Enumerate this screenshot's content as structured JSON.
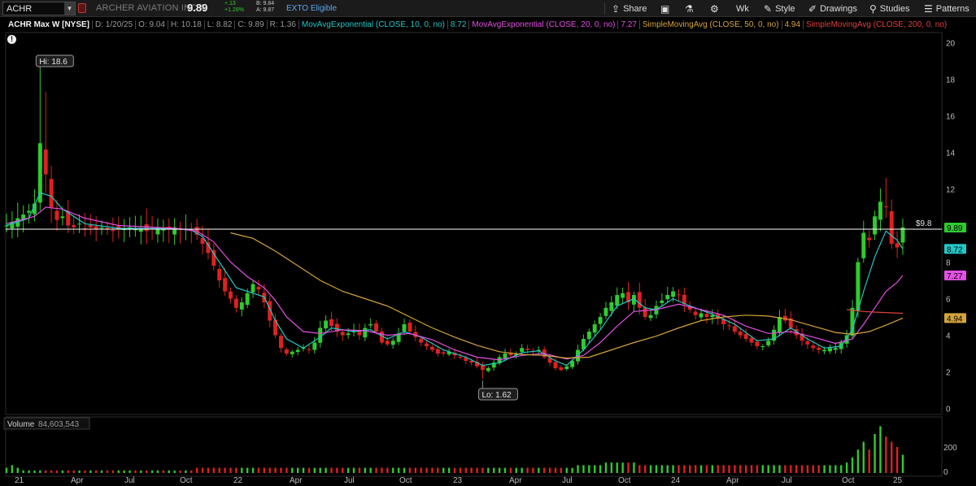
{
  "toolbar": {
    "symbol": "ACHR",
    "company_name": "ARCHER AVIATION INC A",
    "last_price": "9.89",
    "change": "+.13",
    "change_pct": "+1.28%",
    "bid": "B: 9.84",
    "ask": "A: 9.87",
    "exto": "EXTO Eligible",
    "share_label": "Share",
    "timeframe_label": "Wk",
    "style_label": "Style",
    "drawings_label": "Drawings",
    "studies_label": "Studies",
    "patterns_label": "Patterns"
  },
  "chart_header": {
    "title": "ACHR Max W [NYSE]",
    "date": "D: 1/20/25",
    "open": "O: 9.04",
    "high": "H: 10.18",
    "low": "L: 8.82",
    "close": "C: 9.89",
    "range": "R: 1.36",
    "studies": [
      {
        "label": "MovAvgExponential (CLOSE, 10, 0, no)",
        "value": "8.72",
        "color": "#23c7c7"
      },
      {
        "label": "MovAvgExponential (CLOSE, 20, 0, no)",
        "value": "7.27",
        "color": "#e54fe5"
      },
      {
        "label": "SimpleMovingAvg (CLOSE, 50, 0, no)",
        "value": "4.94",
        "color": "#d4a53b"
      },
      {
        "label": "SimpleMovingAvg (CLOSE, 200, 0, no)",
        "value": "",
        "color": "#e04040"
      }
    ]
  },
  "annotations": {
    "hi_label": "Hi: 18.6",
    "lo_label": "Lo: 1.62",
    "price_line_label": "$9.8",
    "price_line_value": 9.8
  },
  "badges": [
    {
      "text": "9.89",
      "value": 9.89,
      "color": "#2ecc2e"
    },
    {
      "text": "8.72",
      "value": 8.72,
      "color": "#23c7c7"
    },
    {
      "text": "7.27",
      "value": 7.27,
      "color": "#e54fe5"
    },
    {
      "text": "4.94",
      "value": 4.94,
      "color": "#d4a53b"
    }
  ],
  "volume": {
    "label": "Volume",
    "value": "84,603,543",
    "y_ticks": [
      "200",
      "0"
    ]
  },
  "chart_data": {
    "type": "candlestick",
    "y_ticks": [
      20,
      18,
      16,
      14,
      12,
      10,
      8,
      6,
      4,
      2,
      0
    ],
    "ylim": [
      0,
      20.5
    ],
    "x_labels": [
      "21",
      "Apr",
      "Jul",
      "Oct",
      "22",
      "Apr",
      "Jul",
      "Oct",
      "23",
      "Apr",
      "Jul",
      "Oct",
      "24",
      "Apr",
      "Jul",
      "Oct",
      "25"
    ],
    "close_path": [
      [
        0,
        10.0
      ],
      [
        1,
        10.2
      ],
      [
        2,
        10.4
      ],
      [
        3,
        10.6
      ],
      [
        4,
        10.8
      ],
      [
        5,
        11.2
      ],
      [
        6,
        14.5
      ],
      [
        7,
        12.8
      ],
      [
        8,
        11.0
      ],
      [
        9,
        10.3
      ],
      [
        10,
        10.5
      ],
      [
        11,
        10.0
      ],
      [
        12,
        9.9
      ],
      [
        13,
        10.1
      ],
      [
        14,
        9.8
      ],
      [
        15,
        9.9
      ],
      [
        16,
        9.8
      ],
      [
        17,
        9.9
      ],
      [
        18,
        9.8
      ],
      [
        19,
        9.7
      ],
      [
        20,
        9.8
      ],
      [
        21,
        9.8
      ],
      [
        22,
        9.9
      ],
      [
        23,
        9.8
      ],
      [
        24,
        9.8
      ],
      [
        25,
        9.7
      ],
      [
        26,
        9.8
      ],
      [
        27,
        9.9
      ],
      [
        28,
        9.8
      ],
      [
        29,
        9.8
      ],
      [
        30,
        9.9
      ],
      [
        31,
        9.8
      ],
      [
        32,
        9.8
      ],
      [
        33,
        9.7
      ],
      [
        34,
        9.5
      ],
      [
        35,
        9.0
      ],
      [
        36,
        8.5
      ],
      [
        37,
        7.8
      ],
      [
        38,
        7.0
      ],
      [
        39,
        6.4
      ],
      [
        40,
        6.0
      ],
      [
        41,
        5.5
      ],
      [
        42,
        5.8
      ],
      [
        43,
        6.3
      ],
      [
        44,
        6.8
      ],
      [
        45,
        6.5
      ],
      [
        46,
        5.8
      ],
      [
        47,
        4.8
      ],
      [
        48,
        4.0
      ],
      [
        49,
        3.3
      ],
      [
        50,
        3.0
      ],
      [
        51,
        3.1
      ],
      [
        52,
        3.2
      ],
      [
        53,
        3.3
      ],
      [
        54,
        3.2
      ],
      [
        55,
        3.6
      ],
      [
        56,
        4.4
      ],
      [
        57,
        4.8
      ],
      [
        58,
        4.5
      ],
      [
        59,
        4.2
      ],
      [
        60,
        4.0
      ],
      [
        61,
        4.1
      ],
      [
        62,
        4.3
      ],
      [
        63,
        4.0
      ],
      [
        64,
        4.4
      ],
      [
        65,
        4.6
      ],
      [
        66,
        4.2
      ],
      [
        67,
        3.6
      ],
      [
        68,
        3.5
      ],
      [
        69,
        3.7
      ],
      [
        70,
        4.1
      ],
      [
        71,
        4.6
      ],
      [
        72,
        4.2
      ],
      [
        73,
        3.9
      ],
      [
        74,
        3.6
      ],
      [
        75,
        3.4
      ],
      [
        76,
        3.2
      ],
      [
        77,
        3.0
      ],
      [
        78,
        3.0
      ],
      [
        79,
        3.1
      ],
      [
        80,
        2.9
      ],
      [
        81,
        2.8
      ],
      [
        82,
        2.6
      ],
      [
        83,
        2.5
      ],
      [
        84,
        2.3
      ],
      [
        85,
        2.1
      ],
      [
        86,
        2.2
      ],
      [
        87,
        2.5
      ],
      [
        88,
        2.8
      ],
      [
        89,
        3.0
      ],
      [
        90,
        2.9
      ],
      [
        91,
        3.0
      ],
      [
        92,
        3.3
      ],
      [
        93,
        3.2
      ],
      [
        94,
        3.1
      ],
      [
        95,
        3.2
      ],
      [
        96,
        2.8
      ],
      [
        97,
        2.5
      ],
      [
        98,
        2.2
      ],
      [
        99,
        2.1
      ],
      [
        100,
        2.3
      ],
      [
        101,
        2.6
      ],
      [
        102,
        3.2
      ],
      [
        103,
        3.8
      ],
      [
        104,
        4.2
      ],
      [
        105,
        4.6
      ],
      [
        106,
        5.0
      ],
      [
        107,
        5.5
      ],
      [
        108,
        5.8
      ],
      [
        109,
        6.2
      ],
      [
        110,
        6.3
      ],
      [
        111,
        5.8
      ],
      [
        112,
        6.2
      ],
      [
        113,
        5.5
      ],
      [
        114,
        5.0
      ],
      [
        115,
        5.1
      ],
      [
        116,
        5.6
      ],
      [
        117,
        5.9
      ],
      [
        118,
        6.2
      ],
      [
        119,
        6.4
      ],
      [
        120,
        6.2
      ],
      [
        121,
        5.7
      ],
      [
        122,
        5.4
      ],
      [
        123,
        5.1
      ],
      [
        124,
        5.2
      ],
      [
        125,
        5.0
      ],
      [
        126,
        5.1
      ],
      [
        127,
        4.9
      ],
      [
        128,
        4.6
      ],
      [
        129,
        4.5
      ],
      [
        130,
        4.2
      ],
      [
        131,
        4.0
      ],
      [
        132,
        3.8
      ],
      [
        133,
        3.6
      ],
      [
        134,
        3.4
      ],
      [
        135,
        3.4
      ],
      [
        136,
        3.7
      ],
      [
        137,
        4.3
      ],
      [
        138,
        5.0
      ],
      [
        139,
        4.8
      ],
      [
        140,
        4.4
      ],
      [
        141,
        4.0
      ],
      [
        142,
        3.7
      ],
      [
        143,
        3.5
      ],
      [
        144,
        3.3
      ],
      [
        145,
        3.2
      ],
      [
        146,
        3.2
      ],
      [
        147,
        3.3
      ],
      [
        148,
        3.3
      ],
      [
        149,
        3.6
      ],
      [
        150,
        4.0
      ],
      [
        151,
        5.5
      ],
      [
        152,
        8.0
      ],
      [
        153,
        9.6
      ],
      [
        154,
        9.2
      ],
      [
        155,
        10.5
      ],
      [
        156,
        11.3
      ],
      [
        157,
        11.0
      ],
      [
        158,
        9.0
      ],
      [
        159,
        8.8
      ],
      [
        160,
        9.9
      ]
    ],
    "series": [
      {
        "name": "MovAvgExponential (CLOSE, 10, 0, no)",
        "color": "#23c7c7",
        "values": [
          [
            0,
            10.0
          ],
          [
            4,
            10.4
          ],
          [
            6,
            11.8
          ],
          [
            8,
            11.6
          ],
          [
            10,
            10.9
          ],
          [
            14,
            10.1
          ],
          [
            20,
            9.85
          ],
          [
            30,
            9.82
          ],
          [
            33,
            9.75
          ],
          [
            35,
            9.4
          ],
          [
            38,
            8.0
          ],
          [
            41,
            6.6
          ],
          [
            44,
            6.3
          ],
          [
            46,
            6.1
          ],
          [
            48,
            4.8
          ],
          [
            50,
            3.8
          ],
          [
            53,
            3.3
          ],
          [
            56,
            3.9
          ],
          [
            58,
            4.4
          ],
          [
            62,
            4.2
          ],
          [
            65,
            4.3
          ],
          [
            68,
            3.8
          ],
          [
            71,
            4.2
          ],
          [
            74,
            3.9
          ],
          [
            78,
            3.2
          ],
          [
            82,
            2.8
          ],
          [
            85,
            2.35
          ],
          [
            88,
            2.5
          ],
          [
            92,
            3.05
          ],
          [
            95,
            3.15
          ],
          [
            98,
            2.6
          ],
          [
            100,
            2.35
          ],
          [
            103,
            3.2
          ],
          [
            106,
            4.3
          ],
          [
            109,
            5.6
          ],
          [
            112,
            6.0
          ],
          [
            114,
            5.5
          ],
          [
            116,
            5.4
          ],
          [
            119,
            6.0
          ],
          [
            122,
            5.6
          ],
          [
            126,
            5.15
          ],
          [
            130,
            4.6
          ],
          [
            134,
            3.7
          ],
          [
            137,
            3.8
          ],
          [
            140,
            4.4
          ],
          [
            143,
            3.8
          ],
          [
            146,
            3.3
          ],
          [
            149,
            3.4
          ],
          [
            151,
            4.3
          ],
          [
            153,
            6.4
          ],
          [
            155,
            8.3
          ],
          [
            157,
            9.7
          ],
          [
            159,
            9.2
          ],
          [
            160,
            8.72
          ]
        ]
      },
      {
        "name": "MovAvgExponential (CLOSE, 20, 0, no)",
        "color": "#e54fe5",
        "values": [
          [
            0,
            10.1
          ],
          [
            5,
            10.5
          ],
          [
            7,
            11.0
          ],
          [
            10,
            10.9
          ],
          [
            14,
            10.4
          ],
          [
            20,
            10.0
          ],
          [
            30,
            9.85
          ],
          [
            34,
            9.7
          ],
          [
            37,
            9.1
          ],
          [
            40,
            8.0
          ],
          [
            43,
            7.2
          ],
          [
            46,
            6.6
          ],
          [
            48,
            5.9
          ],
          [
            50,
            5.0
          ],
          [
            53,
            4.2
          ],
          [
            56,
            4.1
          ],
          [
            60,
            4.3
          ],
          [
            64,
            4.25
          ],
          [
            68,
            4.0
          ],
          [
            72,
            4.1
          ],
          [
            76,
            3.75
          ],
          [
            80,
            3.2
          ],
          [
            84,
            2.8
          ],
          [
            88,
            2.65
          ],
          [
            92,
            2.9
          ],
          [
            96,
            3.0
          ],
          [
            100,
            2.7
          ],
          [
            103,
            2.9
          ],
          [
            106,
            3.6
          ],
          [
            109,
            4.5
          ],
          [
            112,
            5.3
          ],
          [
            116,
            5.4
          ],
          [
            120,
            5.7
          ],
          [
            124,
            5.4
          ],
          [
            128,
            5.1
          ],
          [
            132,
            4.5
          ],
          [
            136,
            4.1
          ],
          [
            140,
            4.2
          ],
          [
            144,
            3.9
          ],
          [
            148,
            3.55
          ],
          [
            151,
            3.8
          ],
          [
            153,
            4.6
          ],
          [
            155,
            5.5
          ],
          [
            157,
            6.4
          ],
          [
            159,
            6.9
          ],
          [
            160,
            7.27
          ]
        ]
      },
      {
        "name": "SimpleMovingAvg (CLOSE, 50, 0, no)",
        "color": "#d4a53b",
        "values": [
          [
            40,
            9.6
          ],
          [
            44,
            9.3
          ],
          [
            48,
            8.6
          ],
          [
            52,
            7.8
          ],
          [
            56,
            7.0
          ],
          [
            60,
            6.4
          ],
          [
            64,
            6.0
          ],
          [
            68,
            5.6
          ],
          [
            72,
            5.0
          ],
          [
            76,
            4.4
          ],
          [
            80,
            3.9
          ],
          [
            84,
            3.45
          ],
          [
            88,
            3.1
          ],
          [
            92,
            2.95
          ],
          [
            96,
            2.9
          ],
          [
            100,
            2.75
          ],
          [
            104,
            2.8
          ],
          [
            108,
            3.2
          ],
          [
            112,
            3.6
          ],
          [
            116,
            3.95
          ],
          [
            120,
            4.4
          ],
          [
            124,
            4.8
          ],
          [
            128,
            5.0
          ],
          [
            132,
            5.1
          ],
          [
            136,
            5.05
          ],
          [
            140,
            4.85
          ],
          [
            144,
            4.5
          ],
          [
            148,
            4.15
          ],
          [
            151,
            4.05
          ],
          [
            154,
            4.2
          ],
          [
            157,
            4.55
          ],
          [
            160,
            4.94
          ]
        ]
      },
      {
        "name": "SimpleMovingAvg (CLOSE, 200, 0, no)",
        "color": "#e04040",
        "values": [
          [
            150,
            5.4
          ],
          [
            153,
            5.3
          ],
          [
            156,
            5.25
          ],
          [
            160,
            5.2
          ]
        ]
      }
    ],
    "volume_levels": [
      2,
      3,
      2,
      1,
      1,
      1,
      1,
      1,
      1,
      1,
      1,
      1,
      1,
      1,
      1,
      1,
      1,
      1,
      1,
      1,
      1,
      1,
      1,
      1,
      1,
      1,
      1,
      1,
      1,
      1,
      1,
      1,
      1,
      1,
      2,
      2,
      2,
      2,
      2,
      2,
      2,
      2,
      2,
      2,
      2,
      2,
      2,
      2,
      2,
      2,
      2,
      2,
      2,
      2,
      2,
      2,
      2,
      2,
      2,
      2,
      2,
      2,
      2,
      2,
      2,
      2,
      2,
      2,
      2,
      2,
      2,
      2,
      2,
      2,
      2,
      2,
      2,
      2,
      2,
      2,
      2,
      2,
      2,
      2,
      2,
      2,
      2,
      2,
      2,
      2,
      2,
      2,
      2,
      2,
      2,
      2,
      2,
      2,
      2,
      2,
      2,
      2,
      3,
      3,
      3,
      3,
      3,
      4,
      4,
      4,
      4,
      4,
      4,
      3,
      3,
      3,
      3,
      3,
      3,
      3,
      3,
      3,
      3,
      3,
      3,
      3,
      3,
      3,
      3,
      3,
      3,
      3,
      3,
      3,
      3,
      3,
      3,
      3,
      3,
      3,
      3,
      3,
      3,
      3,
      3,
      3,
      3,
      3,
      3,
      3,
      4,
      6,
      9,
      12,
      9,
      15,
      18,
      14,
      12,
      10,
      7
    ]
  }
}
